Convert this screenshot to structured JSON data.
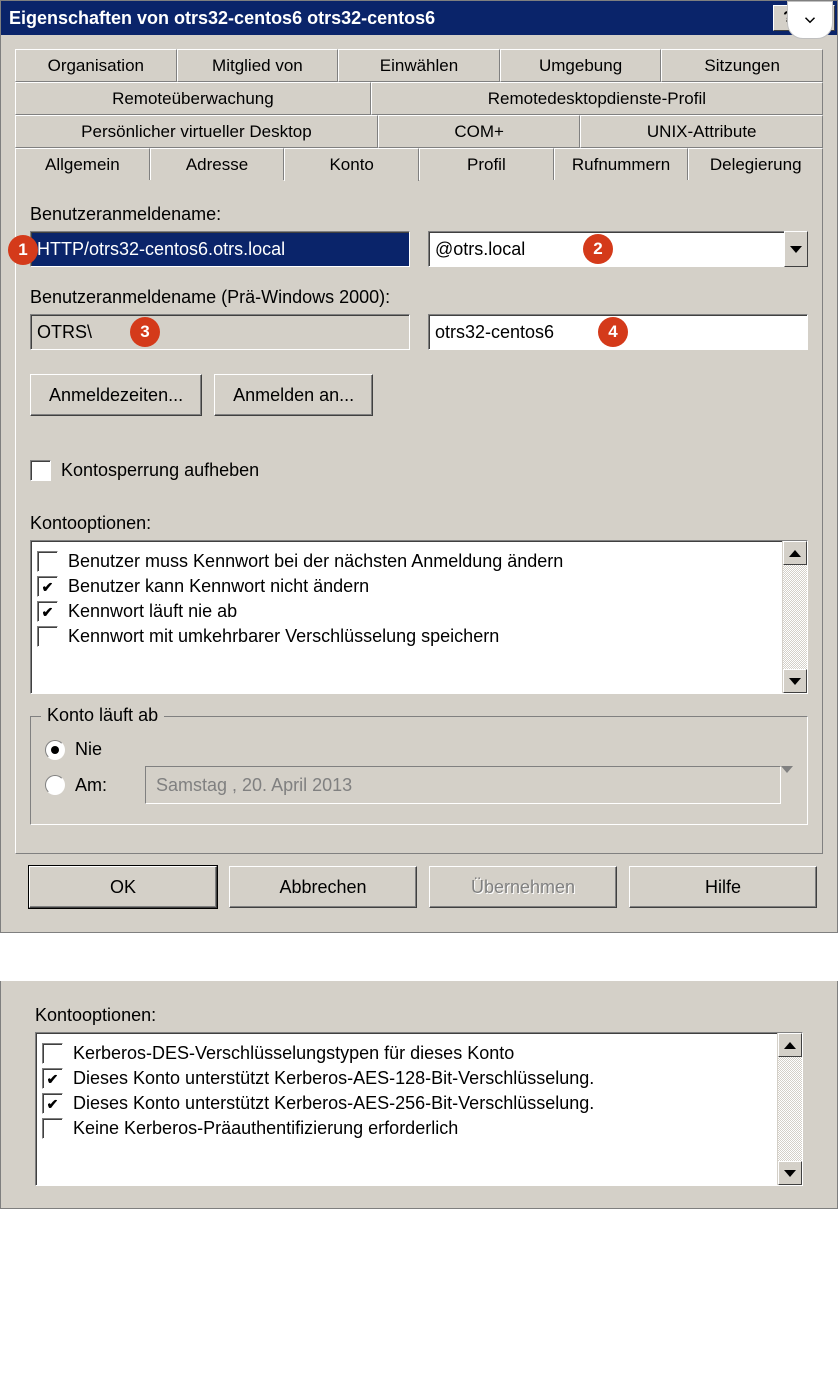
{
  "titlebar": "Eigenschaften von otrs32-centos6 otrs32-centos6",
  "tabs": {
    "row1": [
      "Organisation",
      "Mitglied von",
      "Einwählen",
      "Umgebung",
      "Sitzungen"
    ],
    "row2": [
      "Remoteüberwachung",
      "Remotedesktopdienste-Profil"
    ],
    "row3": [
      "Persönlicher virtueller Desktop",
      "COM+",
      "UNIX-Attribute"
    ],
    "row4": [
      "Allgemein",
      "Adresse",
      "Konto",
      "Profil",
      "Rufnummern",
      "Delegierung"
    ]
  },
  "labels": {
    "logon": "Benutzeranmeldename:",
    "logonPre": "Benutzeranmeldename (Prä-Windows 2000):",
    "kontooptionen": "Kontooptionen:",
    "expiryGroup": "Konto läuft ab"
  },
  "inputs": {
    "logonName": "HTTP/otrs32-centos6.otrs.local",
    "domain": "@otrs.local",
    "preDomain": "OTRS\\",
    "preUser": "otrs32-centos6",
    "expiryDate": "Samstag , 20.    April     2013"
  },
  "buttons": {
    "logonHours": "Anmeldezeiten...",
    "logonTo": "Anmelden an...",
    "ok": "OK",
    "cancel": "Abbrechen",
    "apply": "Übernehmen",
    "help": "Hilfe"
  },
  "checkboxes": {
    "unlock": "Kontosperrung aufheben",
    "opt1": "Benutzer muss Kennwort bei der nächsten Anmeldung ändern",
    "opt2": "Benutzer kann Kennwort nicht ändern",
    "opt3": "Kennwort läuft nie ab",
    "opt4": "Kennwort mit umkehrbarer Verschlüsselung speichern"
  },
  "radios": {
    "never": "Nie",
    "on": "Am:"
  },
  "badges": {
    "b1": "1",
    "b2": "2",
    "b3": "3",
    "b4": "4"
  },
  "panel2checks": {
    "c1": "Kerberos-DES-Verschlüsselungstypen für dieses Konto",
    "c2": "Dieses Konto unterstützt Kerberos-AES-128-Bit-Verschlüsselung.",
    "c3": "Dieses Konto unterstützt Kerberos-AES-256-Bit-Verschlüsselung.",
    "c4": "Keine Kerberos-Präauthentifizierung erforderlich"
  }
}
